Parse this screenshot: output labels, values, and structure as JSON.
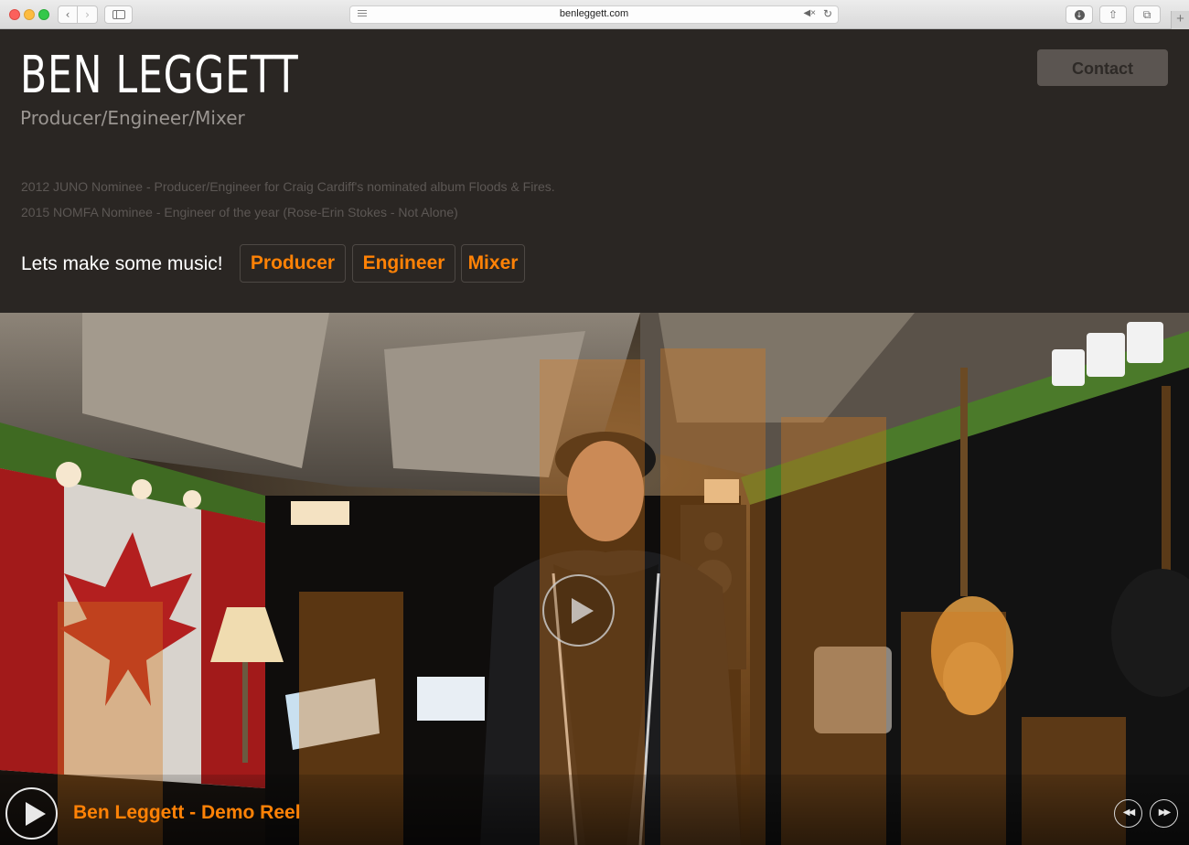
{
  "browser": {
    "url": "benleggett.com",
    "icons": {
      "back": "chevron-left-icon",
      "forward": "chevron-right-icon",
      "sidebar": "sidebar-icon",
      "reader": "reader-icon",
      "mute": "speaker-mute-icon",
      "reload": "reload-icon",
      "downloads": "download-icon",
      "share": "share-icon",
      "tabs": "tabs-icon",
      "new_tab": "plus-icon"
    }
  },
  "header": {
    "logo": "BEN LEGGETT",
    "subtitle": "Producer/Engineer/Mixer",
    "contact_label": "Contact"
  },
  "awards": [
    "2012 JUNO Nominee - Producer/Engineer for Craig Cardiff's nominated album Floods & Fires.",
    "2015 NOMFA Nominee - Engineer of the year (Rose-Erin Stokes - Not Alone)"
  ],
  "cta": {
    "tagline": "Lets make some music!",
    "roles": [
      "Producer",
      "Engineer",
      "Mixer"
    ]
  },
  "player": {
    "track_title": "Ben Leggett - Demo Reel",
    "icons": {
      "overlay_play": "play-icon",
      "play": "play-icon",
      "rewind": "rewind-icon",
      "fast_forward": "fast-forward-icon"
    }
  },
  "colors": {
    "accent": "#ff8206",
    "background": "#2a2623",
    "visualizer": "#d6781c"
  }
}
